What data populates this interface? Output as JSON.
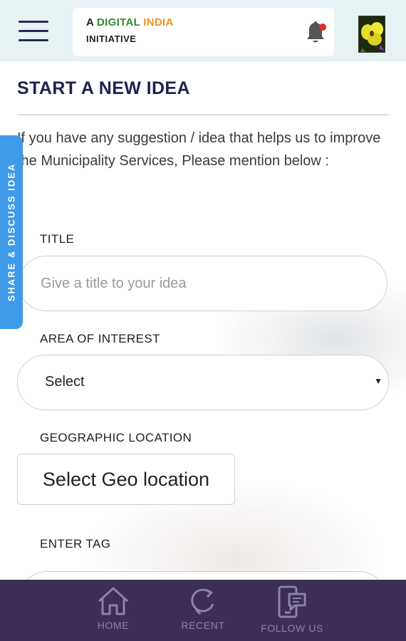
{
  "header": {
    "brand_prefix": "A",
    "brand_digital": "DIGITAL",
    "brand_india": "INDIA",
    "brand_line2": "INITIATIVE",
    "menu_icon": "hamburger-icon",
    "notification_icon": "bell-icon",
    "notification_dot_color": "#e32b2b"
  },
  "side_tab": {
    "label": "SHARE & DISCUSS IDEA",
    "color": "#3f9be8"
  },
  "main": {
    "title": "START A NEW IDEA",
    "intro": "If you have any suggestion / idea that helps us to improve the Municipality Services, Please mention below :",
    "fields": {
      "title_label": "TITLE",
      "title_placeholder": "Give a title to your idea",
      "title_value": "",
      "area_label": "AREA OF INTEREST",
      "area_value": "Select",
      "geo_label": "GEOGRAPHIC LOCATION",
      "geo_button": "Select Geo location",
      "tag_label": "ENTER TAG"
    }
  },
  "bottom_nav": {
    "items": [
      {
        "label": "HOME",
        "icon": "home-icon"
      },
      {
        "label": "RECENT",
        "icon": "refresh-icon"
      },
      {
        "label": "FOLLOW US",
        "icon": "phone-chat-icon"
      }
    ],
    "background": "#3c2e56"
  },
  "colors": {
    "heading": "#1f2150",
    "header_bg": "#e6f2f4",
    "brand_green": "#2e8b2e",
    "brand_orange": "#f0921e"
  }
}
